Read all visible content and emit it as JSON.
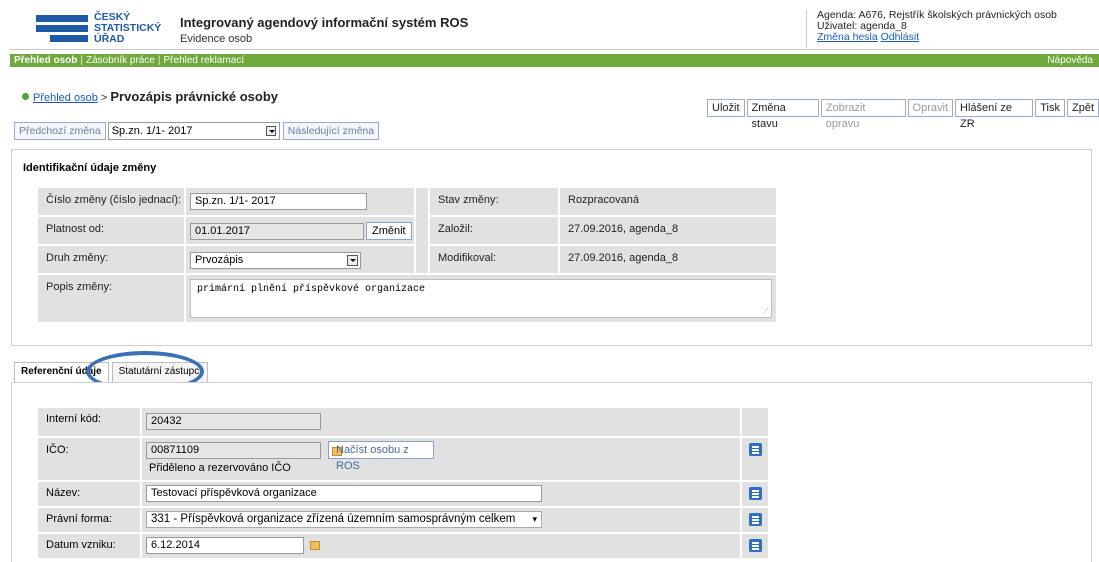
{
  "logo": {
    "line1": "ČESKÝ",
    "line2": "STATISTICKÝ",
    "line3": "ÚŘAD"
  },
  "app": {
    "title": "Integrovaný agendový informační systém ROS",
    "subtitle": "Evidence osob"
  },
  "user": {
    "agenda": "Agenda: A676, Rejstřík školských právnických osob",
    "user": "Uživatel: agenda_8",
    "change_password": "Změna hesla",
    "logout": "Odhlásit"
  },
  "nav": {
    "items": [
      "Přehled osob",
      "Zásobník práce",
      "Přehled reklamací"
    ],
    "help": "Nápověda"
  },
  "breadcrumb": {
    "link": "Přehled osob",
    "sep": ">",
    "current": "Prvozápis právnické osoby"
  },
  "toolbar": [
    "Uložit",
    "Změna stavu",
    "Zobrazit opravu",
    "Opravit",
    "Hlášení ze ZR",
    "Tisk",
    "Zpět"
  ],
  "change_nav": {
    "prev": "Předchozí změna",
    "selected": "Sp.zn. 1/1- 2017",
    "next": "Následující změna"
  },
  "identification": {
    "title": "Identifikační údaje změny",
    "number_label": "Číslo změny (číslo jednací):",
    "number_value": "Sp.zn. 1/1- 2017",
    "validity_label": "Platnost od:",
    "validity_value": "01.01.2017",
    "change_button": "Změnit",
    "type_label": "Druh změny:",
    "type_value": "Prvozápis",
    "desc_label": "Popis změny:",
    "desc_value": "primární plnění příspěvkové organizace",
    "state_label": "Stav změny:",
    "state_value": "Rozpracovaná",
    "created_label": "Založil:",
    "created_value": "27.09.2016, agenda_8",
    "modified_label": "Modifikoval:",
    "modified_value": "27.09.2016, agenda_8"
  },
  "tabs": {
    "ref": "Referenční údaje",
    "stat": "Statutární zástupci"
  },
  "reference": {
    "internal_label": "Interní kód:",
    "internal_value": "20432",
    "ico_label": "IČO:",
    "ico_value": "00871109",
    "ico_note": "Přiděleno a rezervováno IČO",
    "find_button": "Načíst osobu z ROS",
    "name_label": "Název:",
    "name_value": "Testovací příspěvková organizace",
    "legal_label": "Právní forma:",
    "legal_value": "331 - Příspěvková organizace zřízená územním samosprávným celkem",
    "date_label": "Datum vzniku:",
    "date_value": "6.12.2014"
  },
  "colors": {
    "nav_green": "#6fa83b",
    "brand_blue": "#1f5aa6",
    "highlight_circle": "#3d6fb5"
  }
}
